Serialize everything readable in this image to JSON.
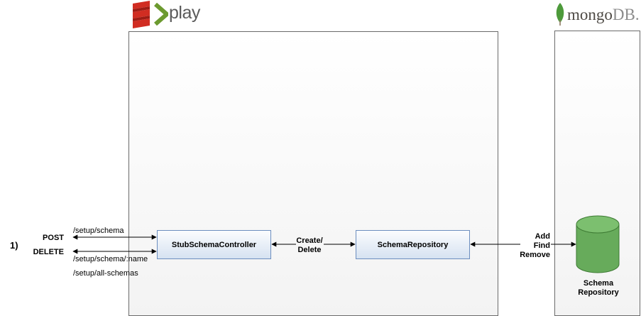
{
  "logos": {
    "play": {
      "wordmark": "play",
      "flame_color": "#d12d22",
      "arrow_color": "#6c9a2f",
      "text_color": "#5b5b5b"
    },
    "mongodb": {
      "wordmark_main": "mongo",
      "wordmark_suffix": "DB.",
      "leaf_color": "#4d9a3b",
      "text_color": "#4e4a45"
    }
  },
  "step": {
    "number": "1)"
  },
  "http": {
    "methods": [
      "POST",
      "DELETE"
    ],
    "routes": [
      "/setup/schema",
      "/setup/schema/:name",
      "/setup/all-schemas"
    ]
  },
  "components": {
    "controller": "StubSchemaController",
    "repository": "SchemaRepository"
  },
  "edges": {
    "controller_repository": [
      "Create/",
      "Delete"
    ],
    "repository_db": [
      "Add",
      "Find",
      "Remove"
    ]
  },
  "database": {
    "label": [
      "Schema",
      "Repository"
    ],
    "color": "#67ab5b"
  }
}
